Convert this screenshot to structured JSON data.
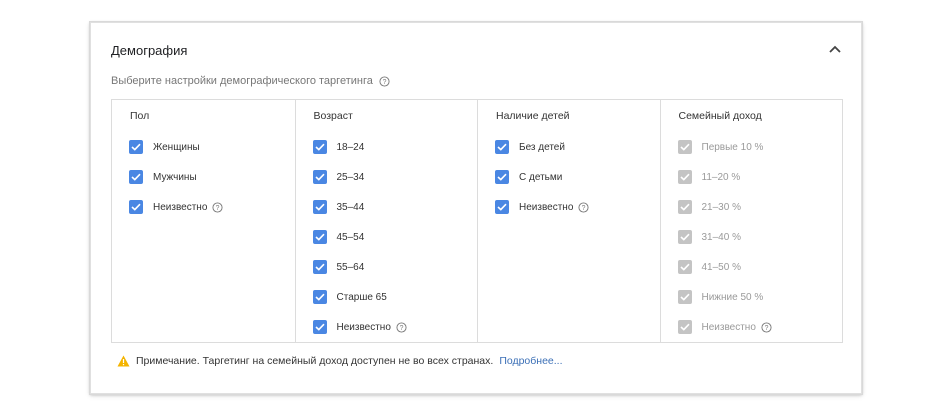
{
  "card": {
    "title": "Демография",
    "subtitle": "Выберите настройки демографического таргетинга"
  },
  "columns": [
    {
      "header": "Пол",
      "options": [
        {
          "label": "Женщины",
          "checked": true,
          "disabled": false,
          "help": false
        },
        {
          "label": "Мужчины",
          "checked": true,
          "disabled": false,
          "help": false
        },
        {
          "label": "Неизвестно",
          "checked": true,
          "disabled": false,
          "help": true
        }
      ]
    },
    {
      "header": "Возраст",
      "options": [
        {
          "label": "18–24",
          "checked": true,
          "disabled": false,
          "help": false
        },
        {
          "label": "25–34",
          "checked": true,
          "disabled": false,
          "help": false
        },
        {
          "label": "35–44",
          "checked": true,
          "disabled": false,
          "help": false
        },
        {
          "label": "45–54",
          "checked": true,
          "disabled": false,
          "help": false
        },
        {
          "label": "55–64",
          "checked": true,
          "disabled": false,
          "help": false
        },
        {
          "label": "Старше 65",
          "checked": true,
          "disabled": false,
          "help": false
        },
        {
          "label": "Неизвестно",
          "checked": true,
          "disabled": false,
          "help": true
        }
      ]
    },
    {
      "header": "Наличие детей",
      "options": [
        {
          "label": "Без детей",
          "checked": true,
          "disabled": false,
          "help": false
        },
        {
          "label": "С детьми",
          "checked": true,
          "disabled": false,
          "help": false
        },
        {
          "label": "Неизвестно",
          "checked": true,
          "disabled": false,
          "help": true
        }
      ]
    },
    {
      "header": "Семейный доход",
      "options": [
        {
          "label": "Первые 10 %",
          "checked": true,
          "disabled": true,
          "help": false
        },
        {
          "label": "11–20 %",
          "checked": true,
          "disabled": true,
          "help": false
        },
        {
          "label": "21–30 %",
          "checked": true,
          "disabled": true,
          "help": false
        },
        {
          "label": "31–40 %",
          "checked": true,
          "disabled": true,
          "help": false
        },
        {
          "label": "41–50 %",
          "checked": true,
          "disabled": true,
          "help": false
        },
        {
          "label": "Нижние 50 %",
          "checked": true,
          "disabled": true,
          "help": false
        },
        {
          "label": "Неизвестно",
          "checked": true,
          "disabled": true,
          "help": true
        }
      ]
    }
  ],
  "note": {
    "text": "Примечание. Таргетинг на семейный доход доступен не во всех странах.",
    "link": "Подробнее..."
  },
  "colors": {
    "checkbox_active": "#4a87e3",
    "checkbox_disabled": "#c4c4c4",
    "warning": "#f4b400",
    "link": "#3b6fb6"
  }
}
